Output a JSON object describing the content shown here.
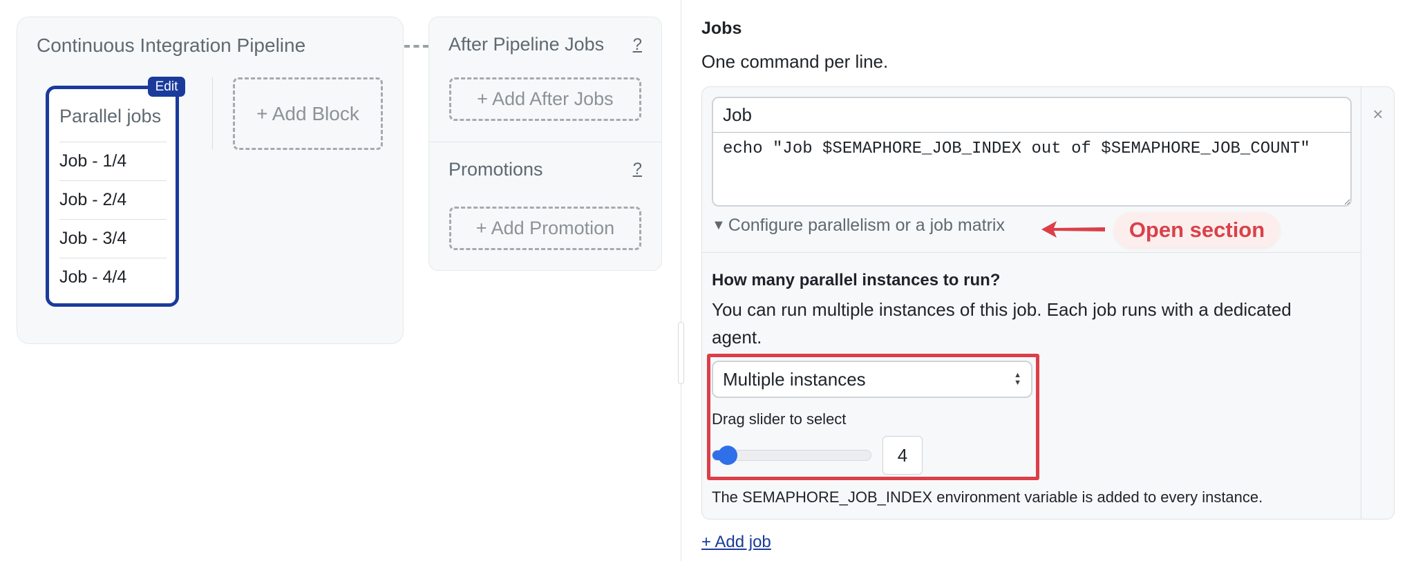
{
  "pipeline": {
    "title": "Continuous Integration Pipeline",
    "block": {
      "edit_label": "Edit",
      "title": "Parallel jobs",
      "jobs": [
        "Job - 1/4",
        "Job - 2/4",
        "Job - 3/4",
        "Job - 4/4"
      ]
    },
    "add_block_label": "+ Add Block"
  },
  "after_pipeline": {
    "title": "After Pipeline Jobs",
    "help": "?",
    "add_label": "+ Add After Jobs"
  },
  "promotions": {
    "title": "Promotions",
    "help": "?",
    "add_label": "+ Add Promotion"
  },
  "jobs_editor": {
    "heading": "Jobs",
    "subheading": "One command per line.",
    "close_icon": "×",
    "job_name": "Job",
    "commands": "echo \"Job $SEMAPHORE_JOB_INDEX out of $SEMAPHORE_JOB_COUNT\"",
    "config_toggle_icon": "▼",
    "config_toggle_label": "Configure parallelism or a job matrix",
    "annotation": {
      "label": "Open section",
      "color": "#d9414a"
    },
    "parallelism": {
      "heading": "How many parallel instances to run?",
      "description": "You can run multiple instances of this job. Each job runs with a dedicated agent.",
      "mode_selected": "Multiple instances",
      "slider_label": "Drag slider to select",
      "slider_value": 4,
      "slider_min": 2,
      "slider_max": 50,
      "count_display": "4",
      "env_note": "The SEMAPHORE_JOB_INDEX environment variable is added to every instance."
    },
    "add_job_label": "+ Add job"
  },
  "colors": {
    "accent": "#1a3b9c",
    "highlight": "#dc3f48",
    "slider": "#2f6fe8"
  }
}
